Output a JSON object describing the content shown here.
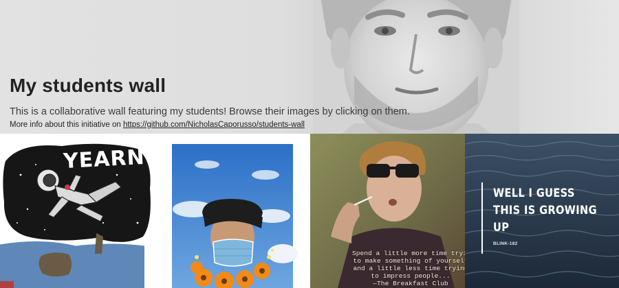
{
  "hero": {
    "title": "My students wall",
    "description": "This is a collaborative wall featuring my students! Browse their images by clicking on them.",
    "more_prefix": "More info about this initiative on ",
    "more_link": "https://github.com/NicholasCaporusso/students-wall"
  },
  "tiles": [
    {
      "name": "yearn-poster",
      "title": "YEARN"
    },
    {
      "name": "portrait-with-mask"
    },
    {
      "name": "breakfast-club-quote",
      "quote_lines": [
        "Spend a little more time trying",
        "to make something of yourself",
        "and a little less time trying",
        "to impress people..."
      ],
      "attribution": "—The Breakfast Club"
    },
    {
      "name": "blink-lyrics",
      "lines": [
        "WELL I GUESS",
        "THIS IS GROWING",
        "UP"
      ],
      "artist": "BLINK-182"
    }
  ],
  "colors": {
    "hero_bg": "#dedede",
    "title": "#222222",
    "ocean": "#263546"
  }
}
